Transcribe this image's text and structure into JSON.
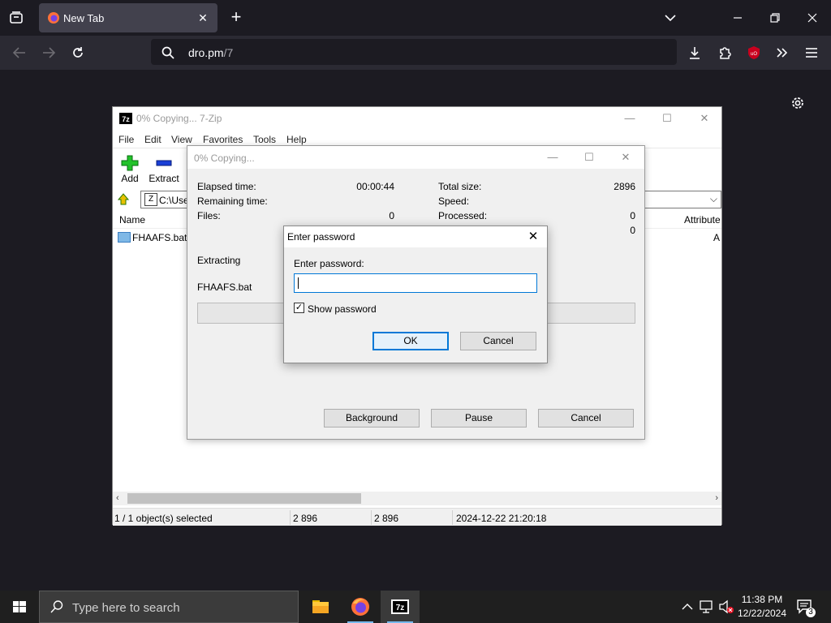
{
  "browser": {
    "tab_title": "New Tab",
    "url_host": "dro.pm",
    "url_path": "/7",
    "tab_close": "✕",
    "new_tab": "+"
  },
  "zip_window": {
    "title": "0% Copying... 7-Zip",
    "app_icon": "7z",
    "menu": [
      "File",
      "Edit",
      "View",
      "Favorites",
      "Tools",
      "Help"
    ],
    "toolbar": {
      "add_label": "Add",
      "extract_label": "Extract"
    },
    "address": "C:\\Use",
    "columns": {
      "name": "Name",
      "attributes": "Attribute"
    },
    "files": [
      {
        "name": "FHAAFS.bat",
        "attr": "A"
      }
    ],
    "status": {
      "selected": "1 / 1 object(s) selected",
      "size": "2 896",
      "packed": "2 896",
      "modified": "2024-12-22 21:20:18"
    }
  },
  "progress_dialog": {
    "title": "0% Copying...",
    "elapsed_label": "Elapsed time:",
    "elapsed_value": "00:00:44",
    "remaining_label": "Remaining time:",
    "files_label": "Files:",
    "files_value": "0",
    "total_size_label": "Total size:",
    "total_size_value": "2896",
    "speed_label": "Speed:",
    "processed_label": "Processed:",
    "processed_value": "0",
    "extra_value": "0",
    "action_label": "Extracting",
    "current_file": "FHAAFS.bat",
    "progress": 0,
    "buttons": {
      "background": "Background",
      "pause": "Pause",
      "cancel": "Cancel"
    }
  },
  "password_dialog": {
    "title": "Enter password",
    "prompt": "Enter password:",
    "password_value": "",
    "show_password_label": "Show password",
    "show_password_checked": true,
    "check_mark": "✓",
    "ok_label": "OK",
    "cancel_label": "Cancel"
  },
  "taskbar": {
    "search_placeholder": "Type here to search",
    "time": "11:38 PM",
    "date": "12/22/2024",
    "notification_count": "3",
    "apps": [
      "file-explorer",
      "firefox",
      "7-zip"
    ]
  },
  "colors": {
    "browser_bg": "#1c1b22",
    "toolbar_bg": "#2b2a33",
    "accent_blue": "#0078d7",
    "taskbar_bg": "#1f1f1f"
  }
}
